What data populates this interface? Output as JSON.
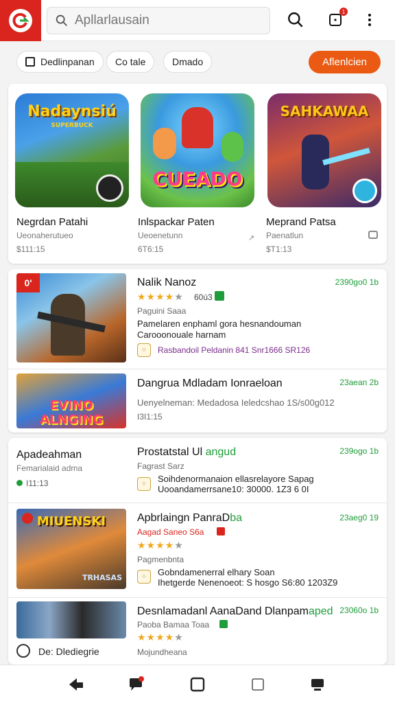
{
  "header": {
    "search_placeholder": "Apllarlausain",
    "notification_count": "1"
  },
  "filters": {
    "chips": [
      "Dedlinpanan",
      "Co tale",
      "Dmado"
    ],
    "cta_label": "Aflenlcien"
  },
  "featured": [
    {
      "art_title": "Nadaynsiú",
      "art_sub": "SUPERBUCK",
      "title": "Negrdan Patahi",
      "subtitle": "Ueonaherutueo",
      "price": "$111:15"
    },
    {
      "art_title": "CUEADO",
      "title": "Inlspackar Paten",
      "subtitle": "Ueoenetunn",
      "price": "6T6:15"
    },
    {
      "art_title": "SAHKAWAA",
      "title": "Meprand Patsa",
      "subtitle": "Paenatlun",
      "price": "$T1:13"
    }
  ],
  "list": [
    {
      "title": "Nalik Nanoz",
      "date": "2390go0 1b",
      "rating_text": "60ú3",
      "category": "Paguini Saaa",
      "desc1": "Pamelaren enphaml gora hesnandouman",
      "desc2": "Carooonouale harnam",
      "tag_text": "Rasbandoil Peldanin  841 Snr1666 SR126",
      "badge": "0'"
    },
    {
      "title": "Dangrua Mdladam Ionraeloan",
      "date": "23aean 2b",
      "line1": "Uenyelneman: Medadosa Ieledcshao 1S/s00g012",
      "line2": "I3I1:15",
      "art_text": "EVINO ALNGING"
    },
    {
      "title": "Apadeahman",
      "subtitle": "Femarialaid adma",
      "price": "I11:13",
      "title2": "Prostatstal Ul",
      "title2_highlight": "angud",
      "date": "239ogo 1b",
      "category": "Fagrast Sarz",
      "desc1": "Soihdenormanaion ellasrelayore Sapag",
      "desc2": "Uooandamerrsane10: 30000. 1Z3 6 0I"
    },
    {
      "title": "Apbrlaingn PanraD",
      "title_highlight": "ba",
      "date": "23aeg0 19",
      "red_line": "Aagad Saneo S6a",
      "category": "Pagmenbnta",
      "desc1": "Gobndamenerral elhary Soan",
      "desc2": "Ihetgerde Nenenoeot: S hosgo S6:80 1203Z9",
      "art_text": "MIUENSKI",
      "art_sub": "TRHASAS"
    },
    {
      "title": "Desnlamadanl AanaDand Dlanpam",
      "title_highlight": "aped",
      "date": "23060o 1b",
      "line1": "Paoba Bamaa Toaa",
      "line2": "Mojundheana",
      "footer_note": "De: Dlediegrie"
    }
  ],
  "colors": {
    "brand_red": "#d9251d",
    "accent_orange": "#ea5a12",
    "date_green": "#1f9d3a",
    "star": "#f0a81c"
  }
}
